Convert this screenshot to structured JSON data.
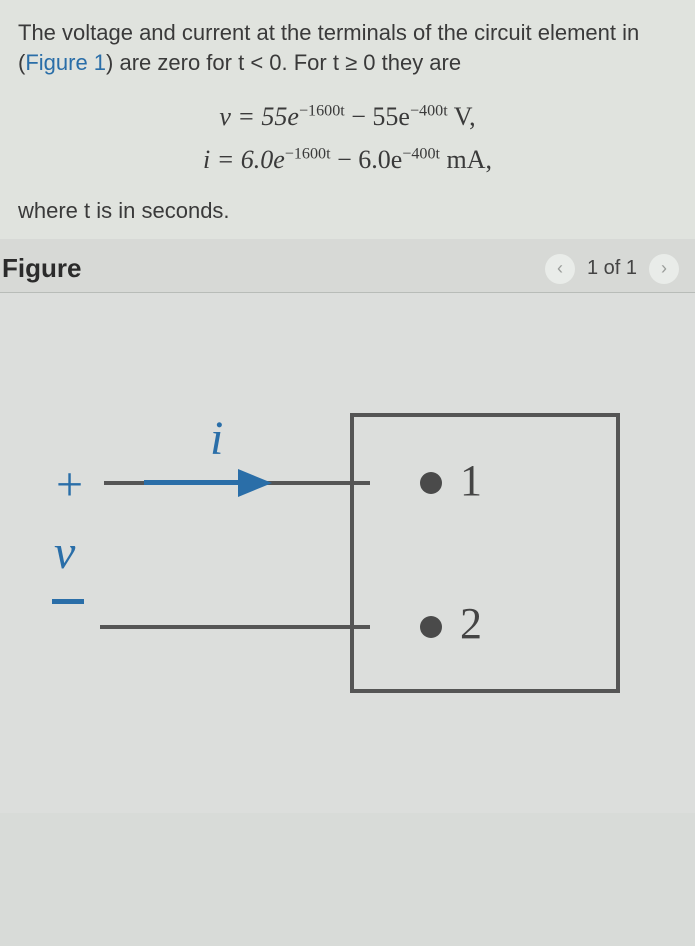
{
  "problem": {
    "intro_pre": "The voltage and current at the terminals of the circuit element in (",
    "figure_ref": "Figure 1",
    "intro_post": ") are zero for t < 0. For t ≥ 0 they are",
    "eq_v_prefix": "v = 55e",
    "eq_v_exp1": "−1600t",
    "eq_v_mid": " − 55e",
    "eq_v_exp2": "−400t",
    "eq_v_suffix": " V,",
    "eq_i_prefix": "i = 6.0e",
    "eq_i_exp1": "−1600t",
    "eq_i_mid": " − 6.0e",
    "eq_i_exp2": "−400t",
    "eq_i_suffix": " mA,",
    "where": "where t is in seconds."
  },
  "figure": {
    "title": "Figure",
    "nav_prev": "‹",
    "nav_count": "1 of 1",
    "nav_next": "›",
    "i_label": "i",
    "v_label": "v",
    "plus": "+",
    "terminal1": "1",
    "terminal2": "2"
  }
}
